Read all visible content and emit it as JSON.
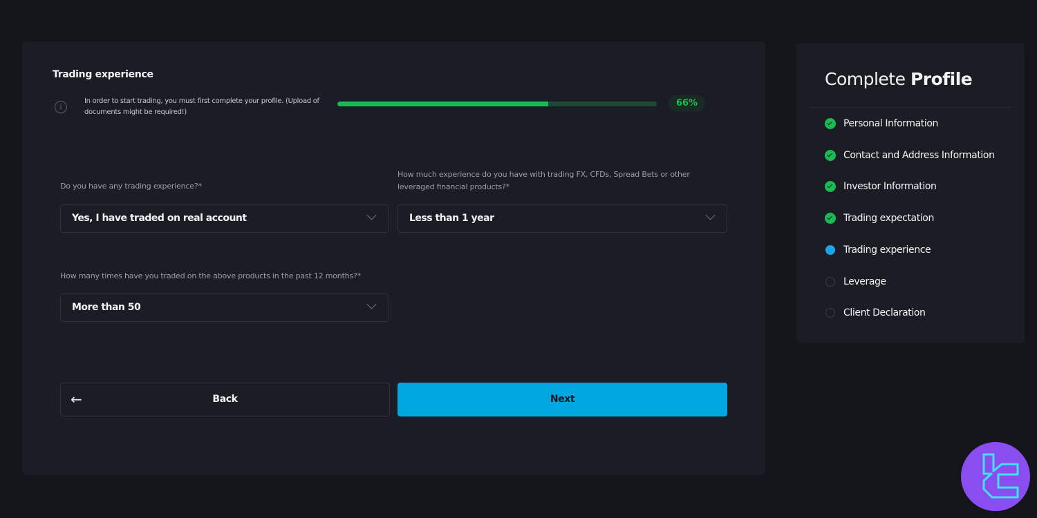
{
  "form": {
    "title": "Trading experience",
    "info_icon": "info-icon",
    "info_text": "In order to start trading, you must first complete your profile. (Upload of documents might be required!)",
    "progress": {
      "percent": 66,
      "label": "66%",
      "color": "#1db954"
    },
    "fields": [
      {
        "label": "Do you have any trading experience?*",
        "value": "Yes, I have traded on real account"
      },
      {
        "label": "How much experience do you have with trading FX, CFDs, Spread Bets or other leveraged financial products?*",
        "value": "Less than 1 year"
      },
      {
        "label": "How many times have you traded on the above products in the past 12 months?*",
        "value": "More than 50"
      }
    ],
    "back_label": "Back",
    "next_label": "Next",
    "accent_color": "#00a6e0"
  },
  "sidebar": {
    "title_light": "Complete",
    "title_bold": "Profile",
    "steps": [
      {
        "label": "Personal Information",
        "status": "done"
      },
      {
        "label": "Contact and Address Information",
        "status": "done"
      },
      {
        "label": "Investor Information",
        "status": "done"
      },
      {
        "label": "Trading expectation",
        "status": "done"
      },
      {
        "label": "Trading experience",
        "status": "current"
      },
      {
        "label": "Leverage",
        "status": "pending"
      },
      {
        "label": "Client Declaration",
        "status": "pending"
      }
    ]
  },
  "watermark": {
    "icon": "tc-logo-icon"
  }
}
